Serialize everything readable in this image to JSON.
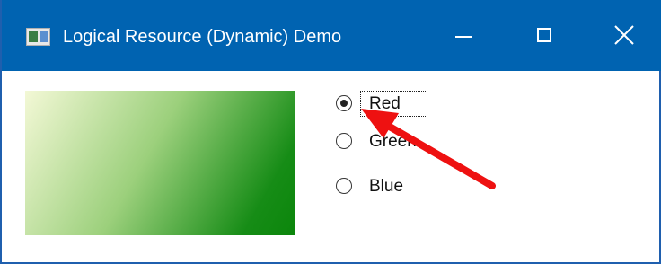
{
  "window": {
    "title": "Logical Resource (Dynamic) Demo"
  },
  "colors": {
    "titlebar": "#0063b1",
    "gradient_start": "#f3f8d6",
    "gradient_end": "#0b860b",
    "annotation_arrow": "#ee1111"
  },
  "icons": {
    "app": "app-window-icon",
    "minimize": "minimize-icon",
    "maximize": "maximize-icon",
    "close": "close-icon",
    "annotation": "red-arrow-icon"
  },
  "radios": {
    "selected": "Red",
    "items": [
      {
        "label": "Red"
      },
      {
        "label": "Green"
      },
      {
        "label": "Blue"
      }
    ]
  }
}
